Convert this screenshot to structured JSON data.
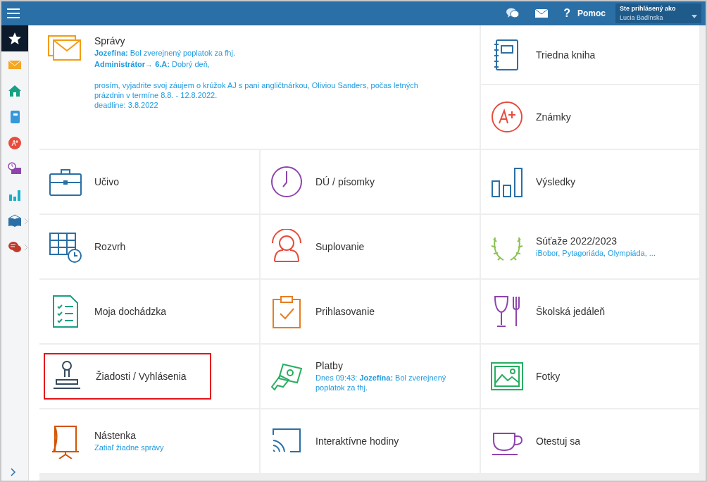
{
  "topbar": {
    "help_icon": "?",
    "help": "Pomoc",
    "user_caption": "Ste prihlásený ako",
    "user_name": "Lucia Badínska"
  },
  "sidebar": {
    "items": [
      {
        "selected": true,
        "has_submenu": false
      },
      {
        "selected": false,
        "has_submenu": false
      },
      {
        "selected": false,
        "has_submenu": false
      },
      {
        "selected": false,
        "has_submenu": false
      },
      {
        "selected": false,
        "has_submenu": false
      },
      {
        "selected": false,
        "has_submenu": false
      },
      {
        "selected": false,
        "has_submenu": false
      },
      {
        "selected": false,
        "has_submenu": true
      },
      {
        "selected": false,
        "has_submenu": true
      }
    ]
  },
  "messages": {
    "title": "Správy",
    "lines": [
      "**Jozefína:** Bol zverejnený poplatok za fhj.",
      "**Administrátor→ 6.A:** Dobrý deň,"
    ],
    "body": [
      "prosím, vyjadrite svoj záujem o krúžok AJ s pani angličtnárkou, Oliviou Sanders, počas letných prázdnin v termíne 8.8. - 12.8.2022.",
      "deadline: 3.8.2022"
    ]
  },
  "tiles": [
    {
      "title": "Triedna kniha",
      "highlighted": false
    },
    {
      "title": "Známky",
      "highlighted": false
    },
    {
      "title": "Učivo",
      "highlighted": false
    },
    {
      "title": "DÚ / písomky",
      "highlighted": false
    },
    {
      "title": "Výsledky",
      "highlighted": false
    },
    {
      "title": "Rozvrh",
      "highlighted": false
    },
    {
      "title": "Suplovanie",
      "highlighted": false
    },
    {
      "title": "Súťaže 2022/2023",
      "subtitle": "iBobor, Pytagoriáda, Olympiáda, ...",
      "highlighted": false
    },
    {
      "title": "Moja dochádzka",
      "highlighted": false
    },
    {
      "title": "Prihlasovanie",
      "highlighted": false
    },
    {
      "title": "Školská jedáleň",
      "highlighted": false
    },
    {
      "title": "Žiadosti / Vyhlásenia",
      "highlighted": true
    },
    {
      "title": "Platby",
      "subtitle": "Dnes 09:43: **Jozefína:** Bol zverejnený poplatok za fhj.",
      "highlighted": false
    },
    {
      "title": "Fotky",
      "highlighted": false
    },
    {
      "title": "Nástenka",
      "subtitle": "Zatiaľ žiadne správy",
      "highlighted": false
    },
    {
      "title": "Interaktívne hodiny",
      "highlighted": false
    },
    {
      "title": "Otestuj sa",
      "highlighted": false
    }
  ]
}
